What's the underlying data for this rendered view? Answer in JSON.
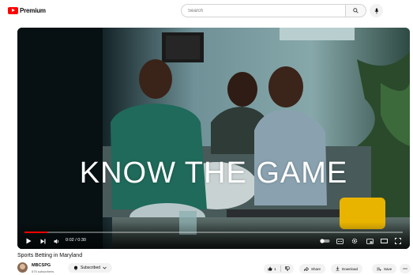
{
  "header": {
    "logo_text": "Premium",
    "search_placeholder": "Search"
  },
  "player": {
    "overlay_text": "KNOW THE GAME",
    "time": "0:02 / 0:30",
    "progress_fraction": 0.06
  },
  "video": {
    "title": "Sports Betting in Maryland",
    "channel_name": "MBCSPG",
    "subscribers": "575 subscribers",
    "subscribe_label": "Subscribed"
  },
  "actions": {
    "like_count": "1",
    "share_label": "Share",
    "download_label": "Download",
    "save_label": "Save"
  },
  "colors": {
    "brand_red": "#ff0000",
    "pill_bg": "#f2f2f2"
  },
  "icons": [
    "youtube-logo-icon",
    "search-icon",
    "mic-icon",
    "play-icon",
    "next-icon",
    "volume-icon",
    "autoplay-toggle-icon",
    "subtitles-icon",
    "settings-icon",
    "miniplayer-icon",
    "theater-icon",
    "fullscreen-icon",
    "bell-icon",
    "chevron-down-icon",
    "thumbs-up-icon",
    "thumbs-down-icon",
    "share-icon",
    "download-icon",
    "save-icon",
    "more-icon"
  ]
}
